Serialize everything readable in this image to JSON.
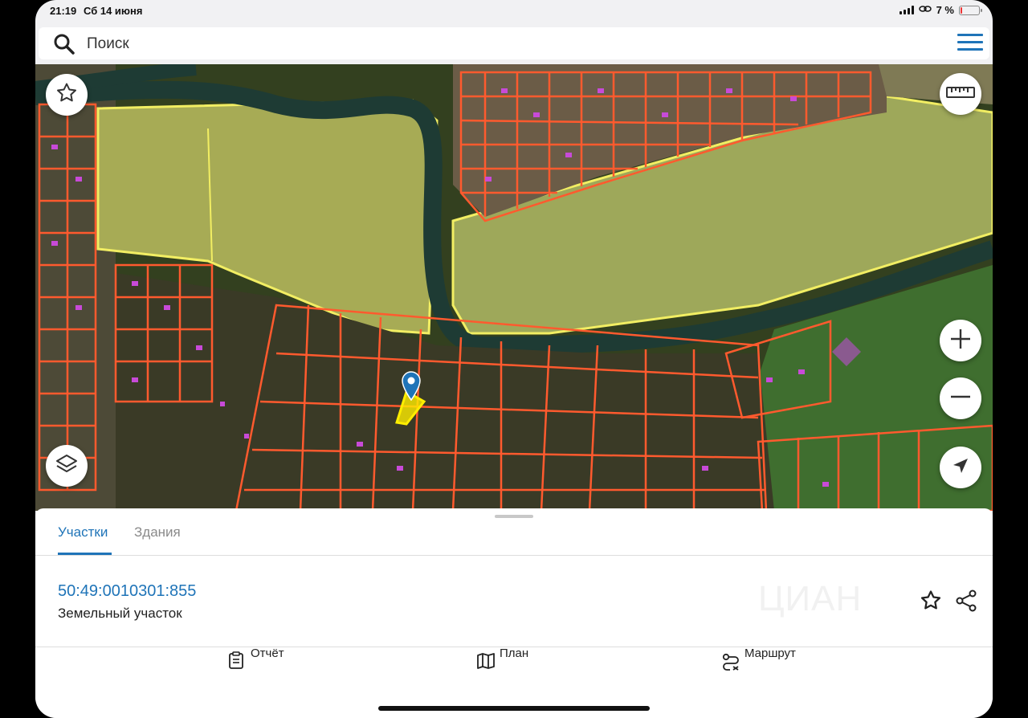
{
  "status_bar": {
    "time": "21:19",
    "date": "Сб 14 июня",
    "battery": "7 %"
  },
  "search": {
    "placeholder": "Поиск"
  },
  "map": {
    "selected_parcel_color": "#ffee00",
    "parcel_outline_color": "#ff5a2e",
    "building_color": "#c84ad8",
    "field_boundary_color": "#f2ee63"
  },
  "sheet": {
    "tabs": [
      {
        "label": "Участки",
        "active": true
      },
      {
        "label": "Здания",
        "active": false
      }
    ],
    "parcel": {
      "cadastral_number": "50:49:0010301:855",
      "type": "Земельный участок"
    },
    "watermark": "ЦИАН"
  },
  "bottom_nav": [
    {
      "label": "Отчёт",
      "icon": "report-icon"
    },
    {
      "label": "План",
      "icon": "map-icon"
    },
    {
      "label": "Маршрут",
      "icon": "route-icon"
    }
  ],
  "colors": {
    "accent": "#1f74b8"
  }
}
